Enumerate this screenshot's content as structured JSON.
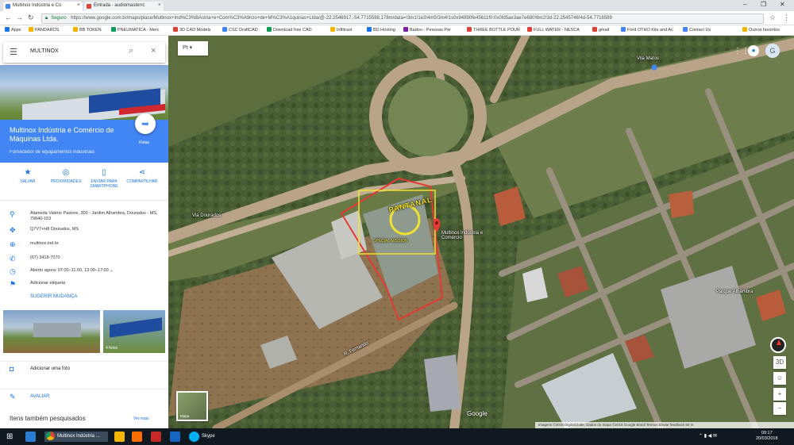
{
  "browser": {
    "tabs": [
      {
        "label": "Multinox Indústria e Co",
        "active": true
      },
      {
        "label": "Entrada - audiomasterrc",
        "active": false
      }
    ],
    "secure_label": "Seguro",
    "url": "https://www.google.com.br/maps/place/Multinox+Ind%C3%BAstria+e+Com%C3%A9rcio+de+M%C3%A1quinas+Ltda/@-22.2546917,-54.7715588,178m/data=!3m1!1e3!4m5!3m4!1s0x94890fe45611f0:0x0fd5ae3ae7e680!8m2!3d-22.2545746!4d-54.7716589",
    "bookmarks": [
      {
        "label": "Apps",
        "color": "#1a73e8"
      },
      {
        "label": "PANDAROS",
        "color": "#f4b400"
      },
      {
        "label": "BB TOKEN",
        "color": "#f4b400"
      },
      {
        "label": "PNEUMATICA - Merc",
        "color": "#0f9d58"
      },
      {
        "label": "3D CAD Models",
        "color": "#db4437"
      },
      {
        "label": "CSC DraftCAD",
        "color": "#4285f4"
      },
      {
        "label": "Download free CAD",
        "color": "#0f9d58"
      },
      {
        "label": "Infiltrast",
        "color": "#f4b400"
      },
      {
        "label": "BD Hosting",
        "color": "#1a73e8"
      },
      {
        "label": "Badoo - Pessoas Per",
        "color": "#7b1fa2"
      },
      {
        "label": "THREE BOTTLE POUR",
        "color": "#db4437"
      },
      {
        "label": "FULL WATER - NESCA",
        "color": "#db4437"
      },
      {
        "label": "gmail",
        "color": "#db4437"
      },
      {
        "label": "Ford OTHO Kits and Ac",
        "color": "#4285f4"
      },
      {
        "label": "Contact Us",
        "color": "#4285f4"
      },
      {
        "label": "Outros favoritos",
        "color": "#f4b400"
      }
    ]
  },
  "panel": {
    "search_value": "MULTINOX",
    "place_name": "Multinox Indústria e Comércio de Máquinas Ltda.",
    "category": "Fornecedor de equipamentos industriais",
    "route_label": "Rotas",
    "actions": [
      {
        "label": "SALVAR",
        "icon": "bookmark-icon",
        "glyph": "★"
      },
      {
        "label": "PROXIMIDADES",
        "icon": "nearby-icon",
        "glyph": "◎"
      },
      {
        "label": "ENVIAR PARA SMARTPHONE",
        "icon": "phone-icon",
        "glyph": "▯"
      },
      {
        "label": "COMPARTILHAR",
        "icon": "share-icon",
        "glyph": "⋖"
      }
    ],
    "info": [
      {
        "icon": "location-pin-icon",
        "glyph": "⚲",
        "text": "Alameda Valério Pastore, 300 - Jardim Alhambra, Dourados - MS, 79840-153"
      },
      {
        "icon": "plus-code-icon",
        "glyph": "✥",
        "text": "Q7V7+H8 Dourados, MS"
      },
      {
        "icon": "globe-icon",
        "glyph": "⊕",
        "text": "multinox.ind.br"
      },
      {
        "icon": "phone-icon",
        "glyph": "✆",
        "text": "(67) 3418-7070"
      },
      {
        "icon": "clock-icon",
        "glyph": "◷",
        "text": "Aberto agora: 07:00–11:00, 13:00–17:00 ⌄"
      },
      {
        "icon": "label-icon",
        "glyph": "⚑",
        "text": "Adicionar etiqueta"
      }
    ],
    "suggest_edit": "SUGERIR MUDANÇA",
    "photos": [
      {
        "caption": ""
      },
      {
        "caption": "4 fotos"
      }
    ],
    "add_photo": "Adicionar uma foto",
    "review": "AVALIAR",
    "also_searched": "Itens também pesquisados",
    "see_more": "Ver mais"
  },
  "map": {
    "layers_label": "Pt",
    "labels": [
      {
        "text": "Via Dourados"
      },
      {
        "text": "Multinox Indústria e Comércio"
      },
      {
        "text": "Parque Alhambra"
      },
      {
        "text": "R. Fernando"
      },
      {
        "text": "Vila Matos"
      }
    ],
    "stamp_line1": "PANTANAL",
    "stamp_line2": "SPECIAL MISSION",
    "google_label": "Google",
    "attribution": "Imagens ©2018 DigitalGlobe, Dados do mapa ©2018 Google   Brasil   Termos   Enviar feedback   50 m"
  },
  "taskbar": {
    "active_window": "Multinox Indústria ...",
    "skype": "Skype",
    "time": "09:17",
    "date": "20/03/2018"
  },
  "colors": {
    "accent": "#4285f4",
    "link": "#1a73e8",
    "taskbar": "#101820",
    "boundary": "#e53935"
  }
}
